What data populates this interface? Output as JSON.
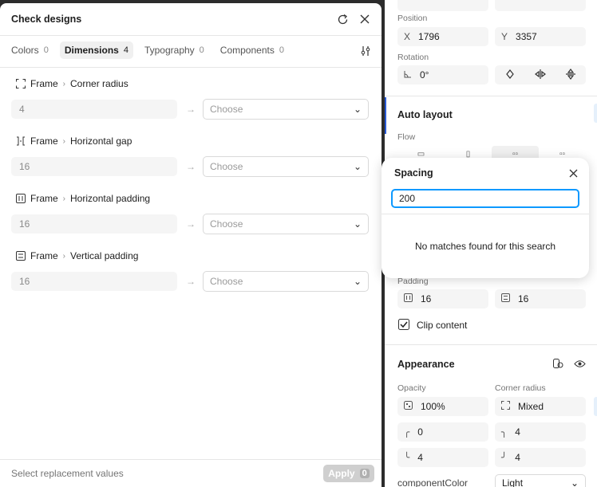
{
  "dialog": {
    "title": "Check designs",
    "tabs": [
      {
        "label": "Colors",
        "count": "0"
      },
      {
        "label": "Dimensions",
        "count": "4"
      },
      {
        "label": "Typography",
        "count": "0"
      },
      {
        "label": "Components",
        "count": "0"
      }
    ],
    "rows": [
      {
        "frame": "Frame",
        "prop": "Corner radius",
        "value": "4",
        "choose": "Choose"
      },
      {
        "frame": "Frame",
        "prop": "Horizontal gap",
        "value": "16",
        "choose": "Choose"
      },
      {
        "frame": "Frame",
        "prop": "Horizontal padding",
        "value": "16",
        "choose": "Choose"
      },
      {
        "frame": "Frame",
        "prop": "Vertical padding",
        "value": "16",
        "choose": "Choose"
      }
    ],
    "footer_text": "Select replacement values",
    "apply_label": "Apply",
    "apply_count": "0"
  },
  "props": {
    "position_label": "Position",
    "x_prefix": "X",
    "x_value": "1796",
    "y_prefix": "Y",
    "y_value": "3357",
    "rotation_label": "Rotation",
    "rotation_value": "0°",
    "auto_layout_title": "Auto layout",
    "flow_label": "Flow",
    "padding_label": "Padding",
    "padding_h": "16",
    "padding_v": "16",
    "clip_label": "Clip content",
    "appearance_title": "Appearance",
    "opacity_label": "Opacity",
    "opacity_value": "100%",
    "corner_radius_label": "Corner radius",
    "corner_radius_value": "Mixed",
    "corner_tl": "0",
    "corner_tr": "4",
    "corner_bl": "4",
    "corner_br": "4",
    "component_color_label": "componentColor",
    "component_color_value": "Light"
  },
  "popover": {
    "title": "Spacing",
    "search_value": "200",
    "message": "No matches found for this search"
  }
}
